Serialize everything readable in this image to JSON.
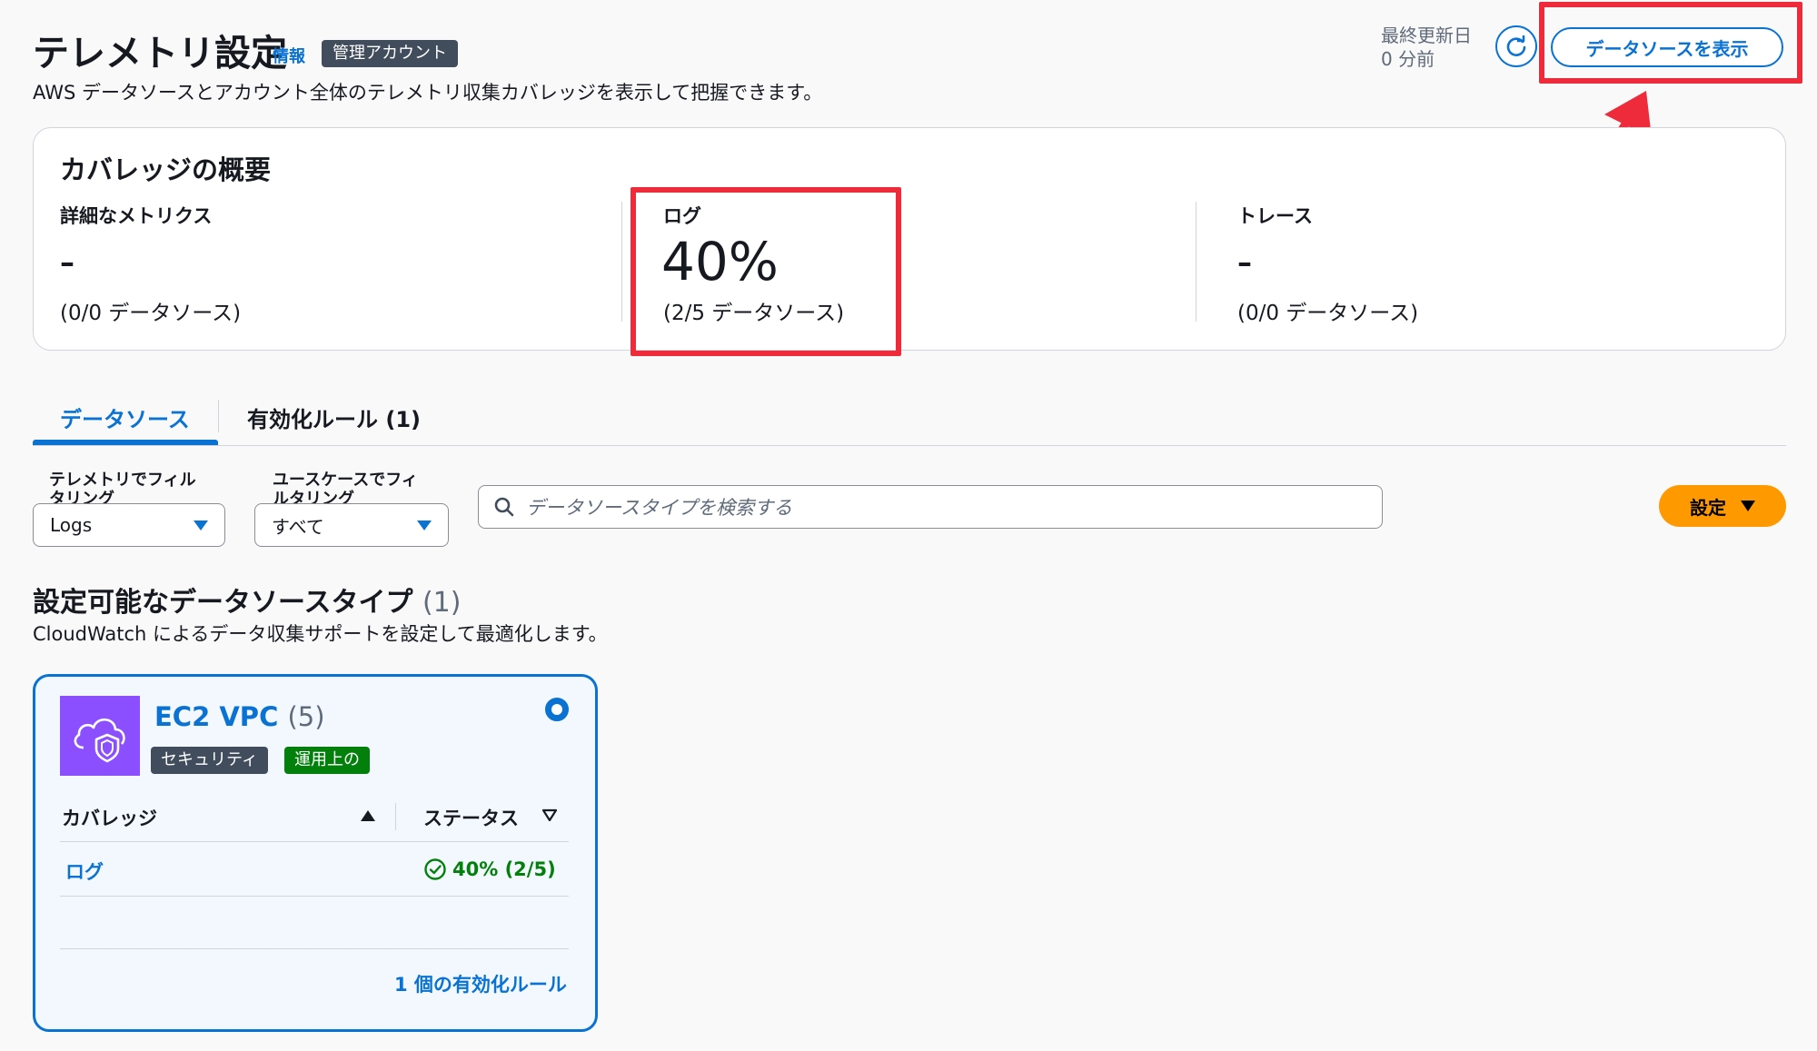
{
  "header": {
    "title": "テレメトリ設定",
    "info_label": "情報",
    "account_badge": "管理アカウント",
    "description": "AWS データソースとアカウント全体のテレメトリ収集カバレッジを表示して把握できます。",
    "last_updated_label": "最終更新日",
    "last_updated_value": "0 分前",
    "view_sources_button": "データソースを表示"
  },
  "overview": {
    "title": "カバレッジの概要",
    "columns": [
      {
        "label": "詳細なメトリクス",
        "value": "–",
        "sub": "(0/0 データソース)"
      },
      {
        "label": "ログ",
        "value": "40%",
        "sub": "(2/5 データソース)"
      },
      {
        "label": "トレース",
        "value": "–",
        "sub": "(0/0 データソース)"
      }
    ]
  },
  "tabs": [
    {
      "label": "データソース",
      "active": true
    },
    {
      "label": "有効化ルール (1)",
      "active": false
    }
  ],
  "filters": {
    "telemetry_label_1": "テレメトリでフィル",
    "telemetry_label_2": "タリング",
    "telemetry_value": "Logs",
    "usecase_label_1": "ユースケースでフィ",
    "usecase_label_2": "ルタリング",
    "usecase_value": "すべて",
    "search_placeholder": "データソースタイプを検索する",
    "settings_button": "設定"
  },
  "section": {
    "title": "設定可能なデータソースタイプ",
    "count": "(1)",
    "description": "CloudWatch によるデータ収集サポートを設定して最適化します。"
  },
  "source_card": {
    "name": "EC2 VPC",
    "count": "(5)",
    "tags": [
      "セキュリティ",
      "運用上の"
    ],
    "tag_colors": [
      "#414d5c",
      "#037f0c"
    ],
    "table": {
      "col_coverage": "カバレッジ",
      "col_status": "ステータス",
      "rows": [
        {
          "coverage": "ログ",
          "status": "40% (2/5)"
        }
      ]
    },
    "rules_link": "1 個の有効化ルール"
  },
  "colors": {
    "accent": "#0972d3",
    "highlight": "#ee2b3b",
    "primary_button": "#ff9900",
    "success": "#037f0c",
    "icon_bg": "#8c4fff"
  }
}
